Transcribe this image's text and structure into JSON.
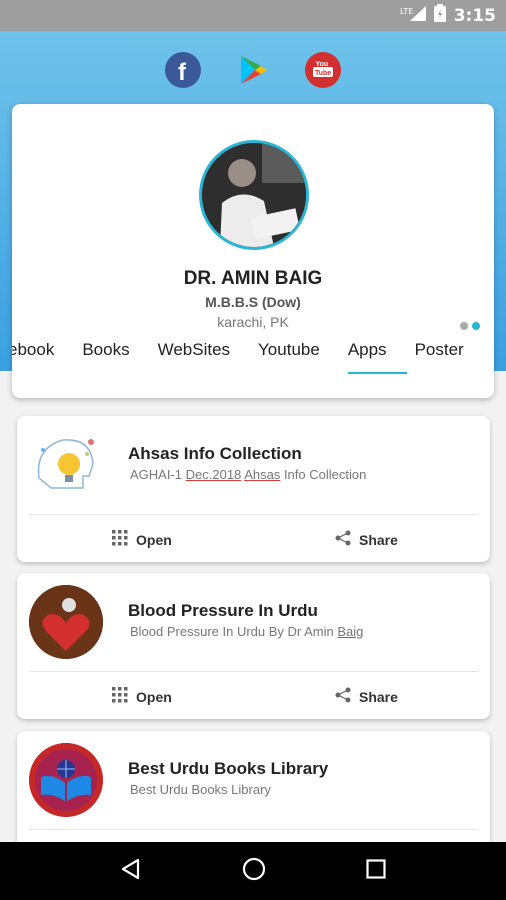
{
  "status_bar": {
    "time": "3:15",
    "network": "LTE"
  },
  "social": [
    {
      "name": "facebook-icon",
      "color": "#3b5998"
    },
    {
      "name": "play-store-icon",
      "color": "#34a853"
    },
    {
      "name": "youtube-icon",
      "color": "#d32f2f",
      "label": "You Tube"
    }
  ],
  "profile": {
    "name": "DR. AMIN BAIG",
    "degree": "M.B.B.S (Dow)",
    "location": "karachi, PK"
  },
  "tabs": [
    {
      "label": "ebook",
      "active": false
    },
    {
      "label": "Books",
      "active": false
    },
    {
      "label": "WebSites",
      "active": false
    },
    {
      "label": "Youtube",
      "active": false
    },
    {
      "label": "Apps",
      "active": true
    },
    {
      "label": "Poster",
      "active": false
    }
  ],
  "apps": [
    {
      "title": "Ahsas Info Collection",
      "subtitle_parts": [
        "AGHAI-1 ",
        "Dec.2018",
        " ",
        "Ahsas",
        " Info Collection"
      ],
      "open_label": "Open",
      "share_label": "Share"
    },
    {
      "title": "Blood Pressure In Urdu",
      "subtitle_parts": [
        "Blood Pressure In Urdu By Dr Amin ",
        "Baig"
      ],
      "open_label": "Open",
      "share_label": "Share"
    },
    {
      "title": "Best Urdu Books Library",
      "subtitle": "Best Urdu Books Library"
    }
  ],
  "colors": {
    "accent": "#29b6d6",
    "header_top": "#6fc3ea",
    "header_bottom": "#3b9fe0"
  }
}
